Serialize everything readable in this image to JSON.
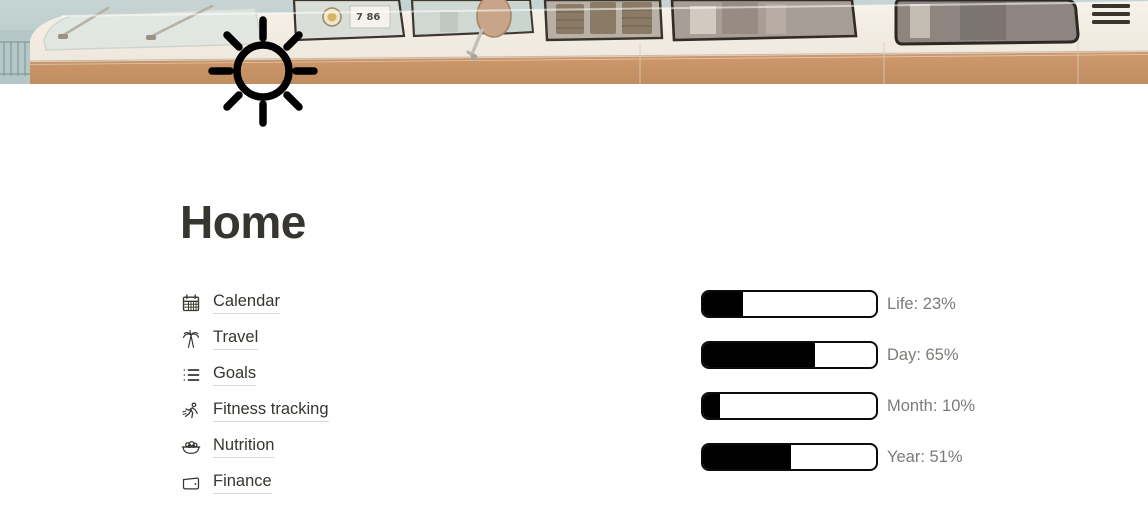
{
  "cover": {
    "name": "cover-image",
    "alt": "Vintage cream and tan Volkswagen bus parked by the water",
    "colors": {
      "sky": "#c9d6d5",
      "water": "#b9c9c8",
      "body_upper": "#f2ece3",
      "body_lower": "#c8956a",
      "window_glass": "#8d8078",
      "trim": "#e8e2d8"
    },
    "decal_text": "7 86"
  },
  "page_icon": {
    "name": "sun-icon",
    "color": "#000000"
  },
  "header": {
    "title": "Home"
  },
  "nav": {
    "items": [
      {
        "label": "Calendar",
        "icon": "calendar-icon"
      },
      {
        "label": "Travel",
        "icon": "palm-tree-icon"
      },
      {
        "label": "Goals",
        "icon": "bulleted-list-icon"
      },
      {
        "label": "Fitness tracking",
        "icon": "running-person-icon"
      },
      {
        "label": "Nutrition",
        "icon": "salad-bowl-icon"
      },
      {
        "label": "Finance",
        "icon": "wallet-icon"
      }
    ]
  },
  "progress": {
    "bars": [
      {
        "label": "Life: 23%",
        "key": "Life",
        "percent": 23
      },
      {
        "label": "Day: 65%",
        "key": "Day",
        "percent": 65
      },
      {
        "label": "Month: 10%",
        "key": "Month",
        "percent": 10
      },
      {
        "label": "Year: 51%",
        "key": "Year",
        "percent": 51
      }
    ],
    "fill_color": "#000000",
    "track_border_color": "#0c0c0c",
    "label_color": "#7c7b77"
  }
}
